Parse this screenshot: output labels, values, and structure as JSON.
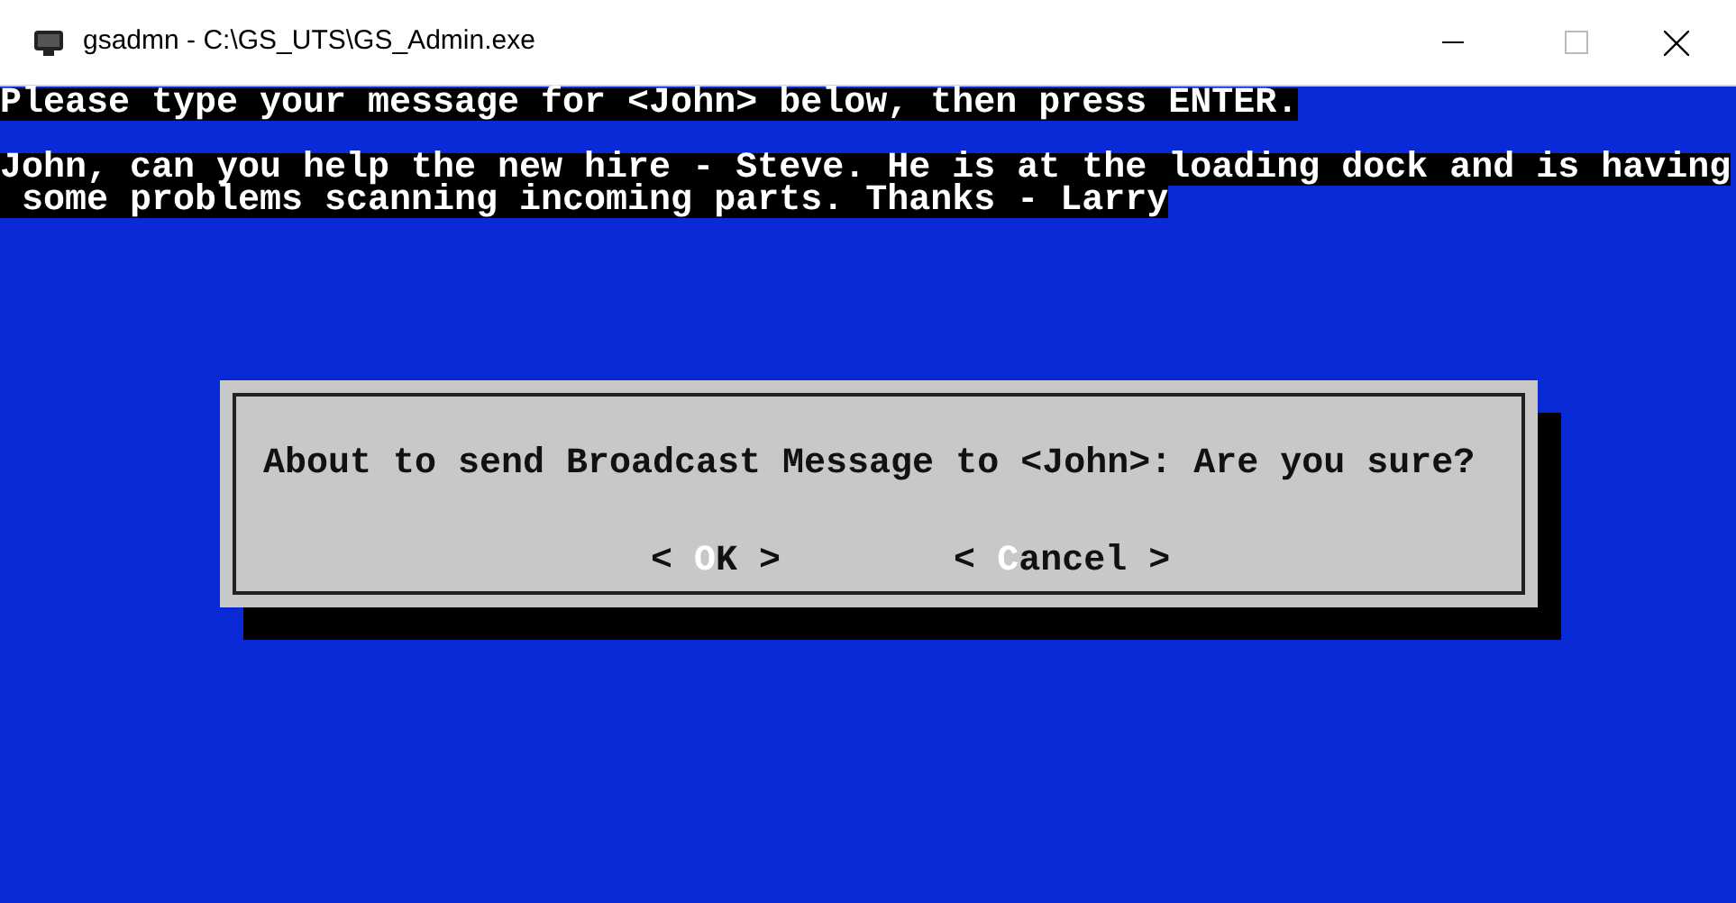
{
  "window": {
    "title": "gsadmn - C:\\GS_UTS\\GS_Admin.exe"
  },
  "console": {
    "lines": [
      {
        "kind": "text",
        "text": "Please type your message for <John> below, then press ENTER."
      },
      {
        "kind": "blank"
      },
      {
        "kind": "text",
        "text": "John, can you help the new hire - Steve. He is at the loading dock and is having"
      },
      {
        "kind": "text",
        "text": " some problems scanning incoming parts. Thanks - Larry"
      }
    ]
  },
  "dialog": {
    "message": "About to send Broadcast Message to <John>: Are you sure?",
    "buttons": [
      {
        "label": "< **O**K >"
      },
      {
        "label": "< **C**ancel >"
      }
    ]
  }
}
